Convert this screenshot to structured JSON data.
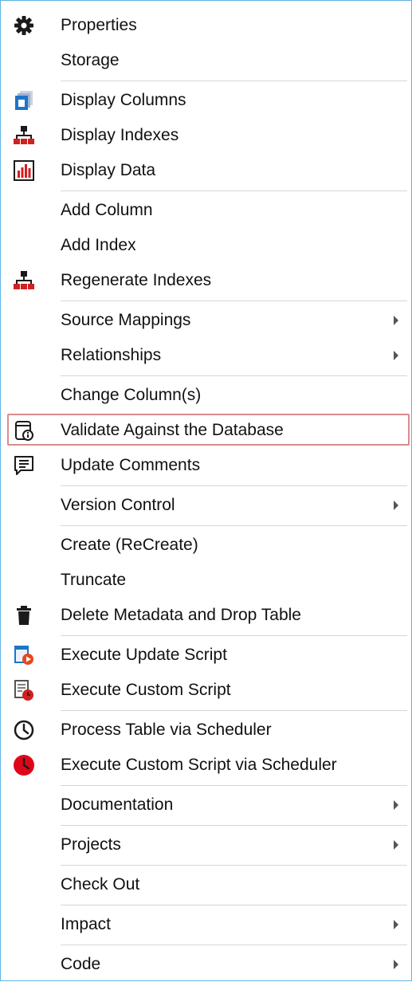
{
  "menu": {
    "items": [
      {
        "label": "Properties",
        "icon": "gear-icon",
        "submenu": false
      },
      {
        "label": "Storage",
        "icon": null,
        "submenu": false
      },
      {
        "label": "Display Columns",
        "icon": "display-columns-icon",
        "submenu": false
      },
      {
        "label": "Display Indexes",
        "icon": "indexes-tree-icon",
        "submenu": false
      },
      {
        "label": "Display Data",
        "icon": "display-data-chart-icon",
        "submenu": false
      },
      {
        "label": "Add Column",
        "icon": null,
        "submenu": false
      },
      {
        "label": "Add Index",
        "icon": null,
        "submenu": false
      },
      {
        "label": "Regenerate Indexes",
        "icon": "regenerate-indexes-icon",
        "submenu": false
      },
      {
        "label": "Source Mappings",
        "icon": null,
        "submenu": true
      },
      {
        "label": "Relationships",
        "icon": null,
        "submenu": true
      },
      {
        "label": "Change Column(s)",
        "icon": null,
        "submenu": false
      },
      {
        "label": "Validate Against the Database",
        "icon": "validate-database-icon",
        "submenu": false,
        "highlighted": true
      },
      {
        "label": "Update Comments",
        "icon": "comments-icon",
        "submenu": false
      },
      {
        "label": "Version Control",
        "icon": null,
        "submenu": true
      },
      {
        "label": "Create (ReCreate)",
        "icon": null,
        "submenu": false
      },
      {
        "label": "Truncate",
        "icon": null,
        "submenu": false
      },
      {
        "label": "Delete Metadata and Drop Table",
        "icon": "trash-icon",
        "submenu": false
      },
      {
        "label": "Execute Update Script",
        "icon": "execute-update-script-icon",
        "submenu": false
      },
      {
        "label": "Execute Custom Script",
        "icon": "execute-custom-script-icon",
        "submenu": false
      },
      {
        "label": "Process Table via Scheduler",
        "icon": "clock-icon",
        "submenu": false
      },
      {
        "label": "Execute Custom Script via Scheduler",
        "icon": "red-clock-icon",
        "submenu": false
      },
      {
        "label": "Documentation",
        "icon": null,
        "submenu": true
      },
      {
        "label": "Projects",
        "icon": null,
        "submenu": true
      },
      {
        "label": "Check Out",
        "icon": null,
        "submenu": false
      },
      {
        "label": "Impact",
        "icon": null,
        "submenu": true
      },
      {
        "label": "Code",
        "icon": null,
        "submenu": true
      }
    ]
  }
}
